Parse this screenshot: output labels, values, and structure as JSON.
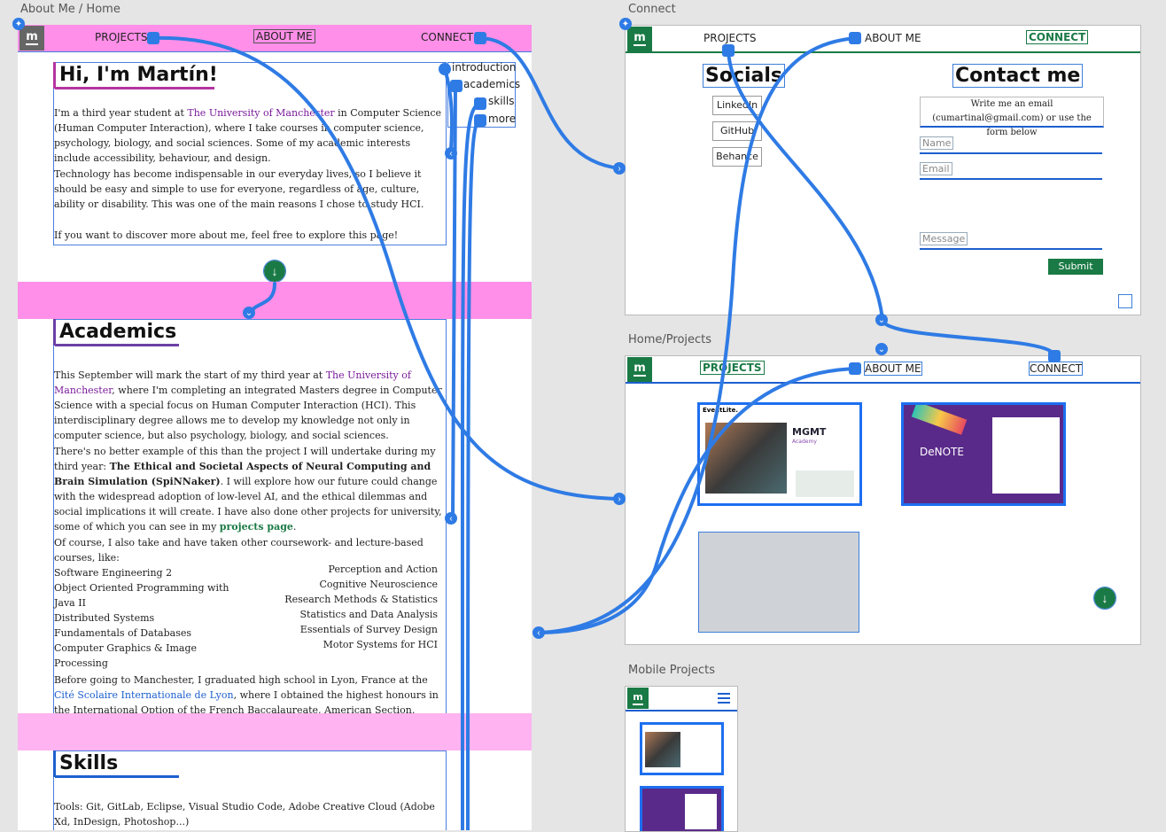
{
  "labels": {
    "home": "About Me / Home",
    "connect": "Connect",
    "projects": "Home/Projects",
    "mobile": "Mobile Projects"
  },
  "logo": "m",
  "nav": {
    "projects": "PROJECTS",
    "about": "ABOUT ME",
    "connect": "CONNECT"
  },
  "home": {
    "title": "Hi, I'm Martín!",
    "side": [
      "introduction",
      "academics",
      "skills",
      "more"
    ],
    "intro_p1_a": "I'm a third year student at ",
    "intro_p1_link": "The University of Manchester",
    "intro_p1_b": " in Computer Science (Human Computer Interaction), where I take courses in computer science, psychology, biology, and social sciences. Some of my academic interests include accessibility, behaviour, and design.",
    "intro_p2": "Technology has become indispensable in our everyday lives, so I believe it should be easy and simple to use for everyone, regardless of age, culture, ability or disability. This was one of the main reasons I chose to study HCI.",
    "intro_p3": "If you want to discover more about me, feel free to explore this page!",
    "academics_title": "Academics",
    "ac_p1_a": "This September will mark the start of my third year at ",
    "ac_p1_link": "The University of Manchester",
    "ac_p1_b": ", where I'm completing an integrated Masters degree in Computer Science with a special focus on Human Computer Interaction (HCI). This interdisciplinary degree allows me to develop my knowledge not only in computer science, but also psychology, biology, and social sciences.",
    "ac_p2_a": "There's no better example of this than the project I will undertake during my third year: ",
    "ac_p2_bold": "The Ethical and Societal Aspects of Neural Computing and Brain Simulation (SpiNNaker)",
    "ac_p2_b": ". I will explore how our future could change with the widespread adoption of low-level AI, and the ethical dilemmas and social implications it will create. I have also done other projects for university, some of which you can see in my ",
    "ac_p2_link": "projects page",
    "ac_p2_c": ".",
    "ac_p3": "Of course, I also take and have taken other coursework- and lecture-based courses, like:",
    "courses_left": [
      "Software Engineering 2",
      "Object Oriented Programming with Java II",
      "Distributed Systems",
      "Fundamentals of Databases",
      "Computer Graphics & Image Processing"
    ],
    "courses_right": [
      "Perception and Action",
      "Cognitive Neuroscience",
      "Research Methods & Statistics",
      "Statistics and Data Analysis",
      "Essentials of Survey Design",
      "Motor Systems for HCI"
    ],
    "ac_p4_a": "Before going to Manchester, I graduated high school in Lyon, France at the ",
    "ac_p4_link": "Cité Scolaire Internationale de Lyon",
    "ac_p4_b": ", where I obtained the highest honours in the International Option of the French Baccalaureate, American Section.",
    "skills_title": "Skills",
    "skills_label": "Tools:",
    "skills_text": " Git, GitLab, Eclipse, Visual Studio Code, Adobe Creative Cloud (Adobe Xd, InDesign, Photoshop...)"
  },
  "connect": {
    "socials_title": "Socials",
    "socials": [
      "LinkedIn",
      "GitHub",
      "Behance"
    ],
    "contact_title": "Contact me",
    "contact_text": "Write me an email (cumartinal@gmail.com) or use the form below",
    "name_ph": "Name",
    "email_ph": "Email",
    "message_ph": "Message",
    "submit": "Submit"
  },
  "projects": {
    "mgmt_brand": "EventLite.",
    "mgmt_title": "MGMT",
    "mgmt_sub": "Academy",
    "denote_title": "DeNOTE"
  },
  "colors": {
    "accent": "#1a7a45",
    "pink": "#ffb3f0",
    "wire": "#2f7be5",
    "purple": "#7a1a9a"
  }
}
